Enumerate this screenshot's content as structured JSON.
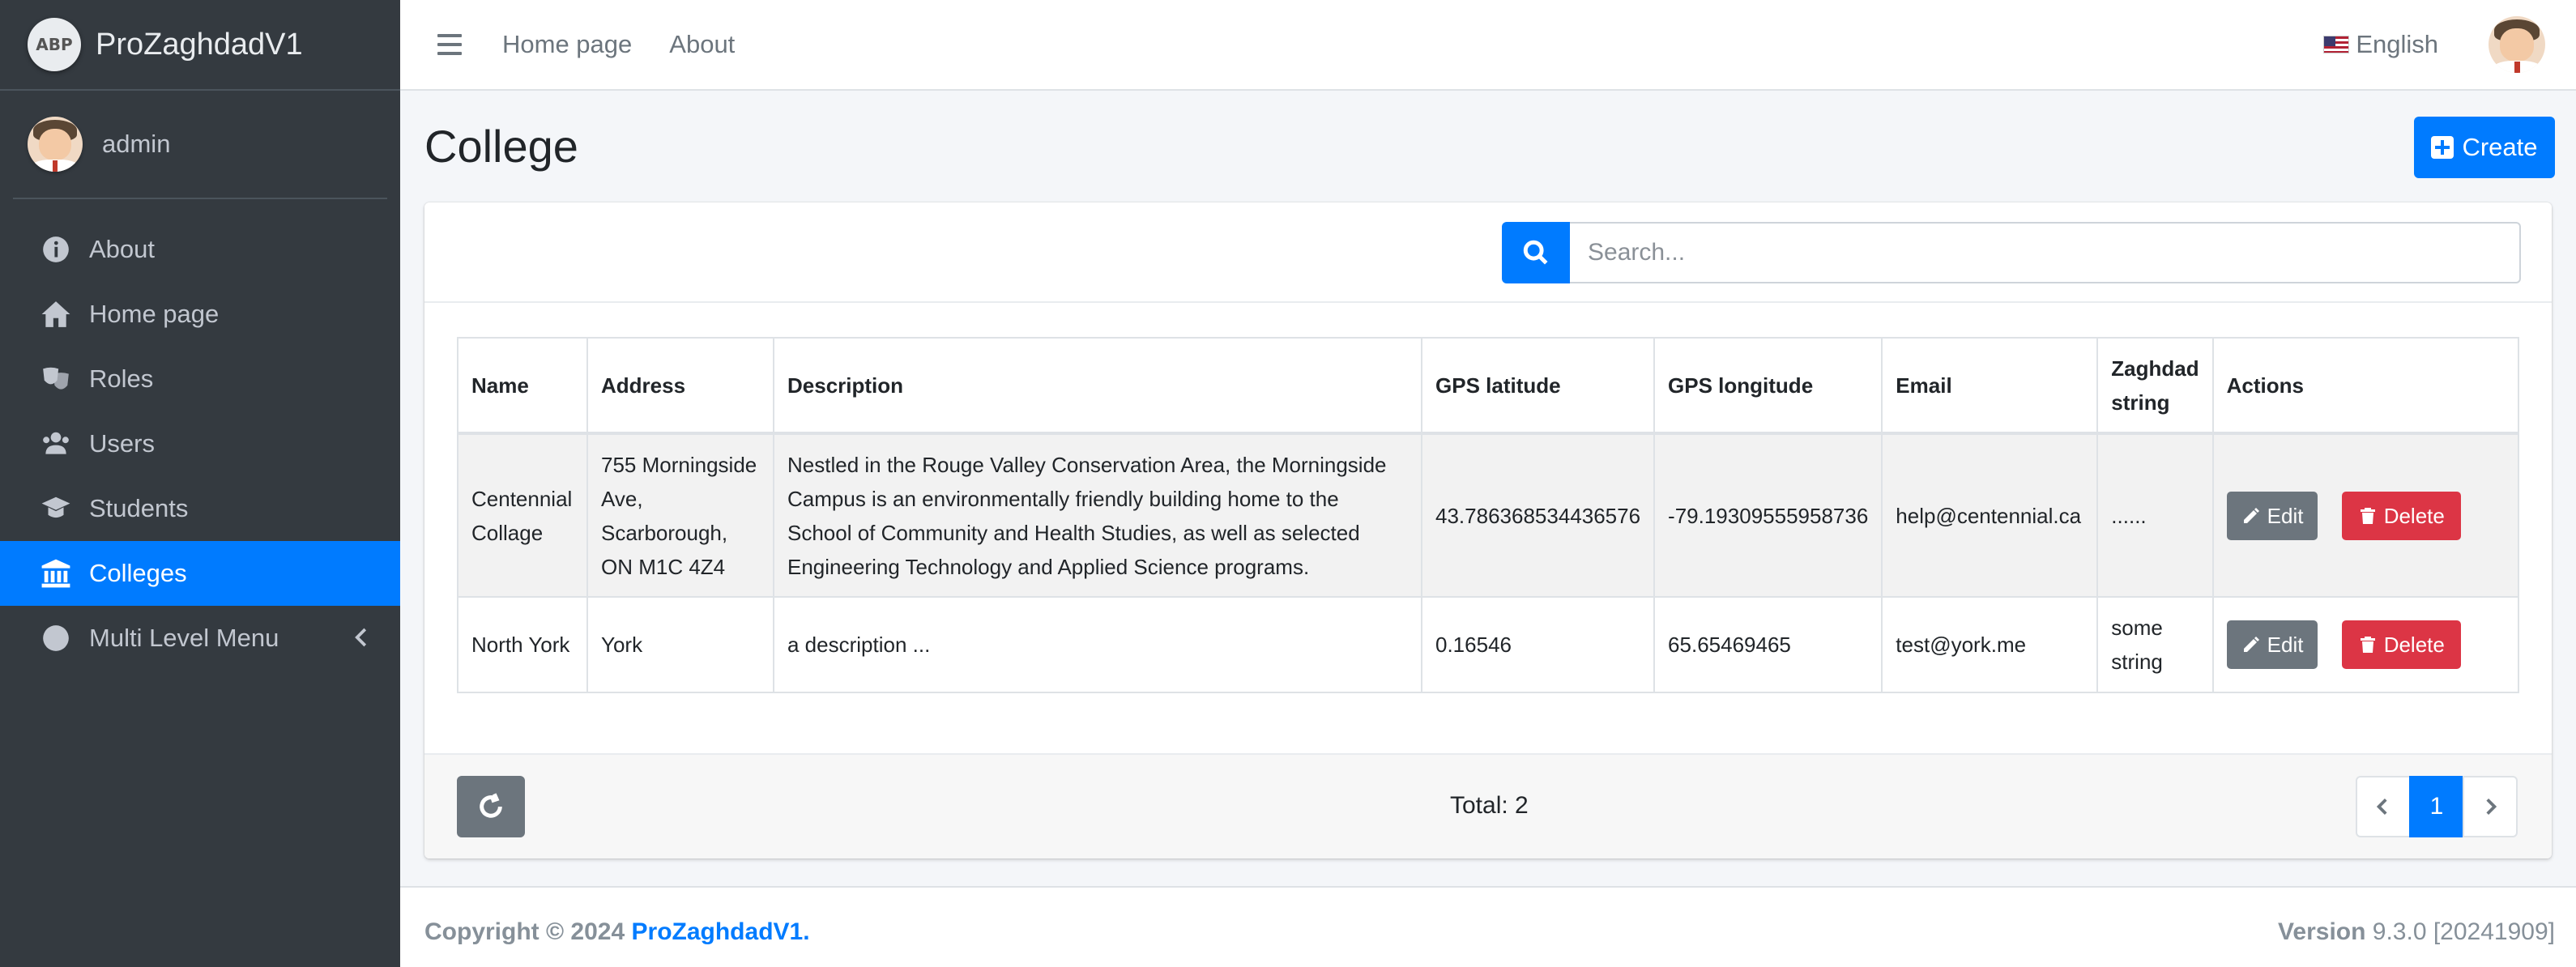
{
  "brand": {
    "logo_text": "ABP",
    "name": "ProZaghdadV1"
  },
  "user": {
    "name": "admin"
  },
  "sidebar": {
    "items": [
      {
        "label": "About",
        "icon": "info-circle-icon"
      },
      {
        "label": "Home page",
        "icon": "home-icon"
      },
      {
        "label": "Roles",
        "icon": "theater-masks-icon"
      },
      {
        "label": "Users",
        "icon": "users-icon"
      },
      {
        "label": "Students",
        "icon": "graduation-cap-icon"
      },
      {
        "label": "Colleges",
        "icon": "university-icon",
        "active": true
      },
      {
        "label": "Multi Level Menu",
        "icon": "circle-icon",
        "has_submenu": true
      }
    ]
  },
  "topbar": {
    "links": [
      "Home page",
      "About"
    ],
    "language": "English"
  },
  "page": {
    "title": "College",
    "create_label": "Create",
    "search_placeholder": "Search..."
  },
  "table": {
    "columns": [
      "Name",
      "Address",
      "Description",
      "GPS latitude",
      "GPS longitude",
      "Email",
      "Zaghdad string",
      "Actions"
    ],
    "rows": [
      {
        "name": "Centennial Collage",
        "address": "755 Morningside Ave, Scarborough, ON M1C 4Z4",
        "description": "Nestled in the Rouge Valley Conservation Area, the Morningside Campus is an environmentally friendly building home to the School of Community and Health Studies, as well as selected Engineering Technology and Applied Science programs.",
        "lat": "43.786368534436576",
        "lng": "-79.19309555958736",
        "email": "help@centennial.ca",
        "zaghdad": "......"
      },
      {
        "name": "North York",
        "address": "York",
        "description": "a description ...",
        "lat": "0.16546",
        "lng": "65.65469465",
        "email": "test@york.me",
        "zaghdad": "some string"
      }
    ],
    "edit_label": "Edit",
    "delete_label": "Delete"
  },
  "footer_bar": {
    "total": "Total: 2",
    "current_page": "1"
  },
  "footer": {
    "copyright": "Copyright © 2024",
    "brand": "ProZaghdadV1",
    "dot": ".",
    "version_label": "Version",
    "version_value": "9.3.0 [20241909]"
  },
  "colors": {
    "primary": "#007bff",
    "danger": "#dc3545",
    "secondary": "#6c757d",
    "sidebar": "#343a40"
  }
}
